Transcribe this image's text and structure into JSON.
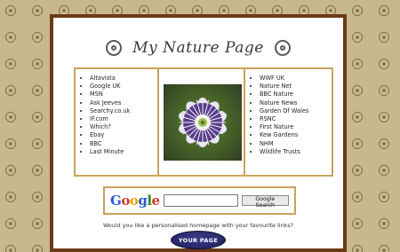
{
  "header": {
    "title": "My Nature Page"
  },
  "left_links": [
    "Altavista",
    "Google UK",
    "MSN",
    "Ask Jeeves",
    "Searchy.co.uk",
    "IF.com",
    "Which?",
    "Ebay",
    "BBC",
    "Last Minute"
  ],
  "right_links": [
    "WWF UK",
    "Nature Net",
    "BBC Nature",
    "Nature News",
    "Garden Of Wales",
    "RSNC",
    "First Nature",
    "Kew Gardens",
    "NHM",
    "Wildlife Trusts"
  ],
  "search": {
    "logo": "Google",
    "input_value": "",
    "button_label": "Google Search"
  },
  "prompt": {
    "text": "Would you like a personalised homepage with your favourite links?"
  },
  "cta": {
    "label": "YOUR PAGE"
  }
}
